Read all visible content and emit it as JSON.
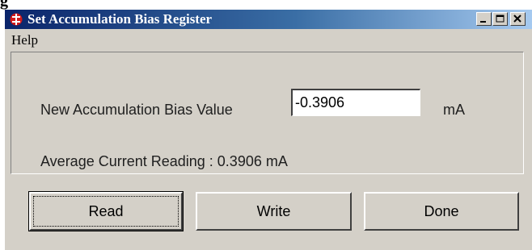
{
  "window": {
    "title": "Set Accumulation Bias Register",
    "icon": "bias-app-icon",
    "controls": [
      "minimize-icon",
      "maximize-icon",
      "close-icon"
    ]
  },
  "fragment": "g",
  "menu": {
    "items": [
      {
        "label": "Help"
      }
    ]
  },
  "form": {
    "bias_label": "New Accumulation Bias Value",
    "bias_value": "-0.3906",
    "unit": "mA",
    "reading_label": "Average Current Reading : 0.3906 mA"
  },
  "buttons": {
    "read": "Read",
    "write": "Write",
    "done": "Done"
  },
  "colors": {
    "title_start": "#0a246a",
    "title_end": "#a6caf0",
    "face": "#d4d0c8",
    "icon_red": "#d21a1a"
  }
}
